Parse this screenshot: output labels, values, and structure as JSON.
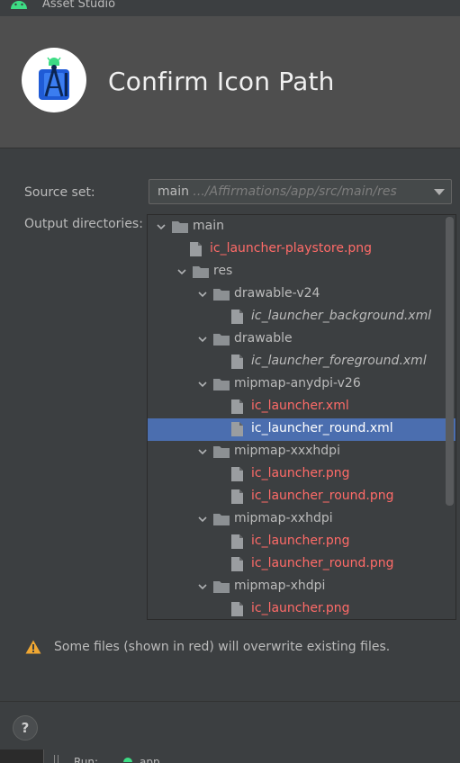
{
  "window": {
    "title": "Asset Studio"
  },
  "header": {
    "title": "Confirm Icon Path",
    "logo_icon": "android-studio-logo"
  },
  "form": {
    "source_set_label": "Source set:",
    "source_set_value": "main",
    "source_set_path": " .../Affirmations/app/src/main/res",
    "output_dirs_label": "Output directories:"
  },
  "tree": [
    {
      "text": "main",
      "kind": "folder",
      "expanded": true,
      "depth": 0,
      "red": false,
      "italic": false,
      "selected": false
    },
    {
      "text": "ic_launcher-playstore.png",
      "kind": "file",
      "depth": 1,
      "red": true,
      "italic": false,
      "selected": false
    },
    {
      "text": "res",
      "kind": "folder",
      "expanded": true,
      "depth": 1,
      "red": false,
      "italic": false,
      "selected": false
    },
    {
      "text": "drawable-v24",
      "kind": "folder",
      "expanded": true,
      "depth": 2,
      "red": false,
      "italic": false,
      "selected": false
    },
    {
      "text": "ic_launcher_background.xml",
      "kind": "file",
      "depth": 3,
      "red": false,
      "italic": true,
      "selected": false
    },
    {
      "text": "drawable",
      "kind": "folder",
      "expanded": true,
      "depth": 2,
      "red": false,
      "italic": false,
      "selected": false
    },
    {
      "text": "ic_launcher_foreground.xml",
      "kind": "file",
      "depth": 3,
      "red": false,
      "italic": true,
      "selected": false
    },
    {
      "text": "mipmap-anydpi-v26",
      "kind": "folder",
      "expanded": true,
      "depth": 2,
      "red": false,
      "italic": false,
      "selected": false
    },
    {
      "text": "ic_launcher.xml",
      "kind": "file",
      "depth": 3,
      "red": true,
      "italic": false,
      "selected": false
    },
    {
      "text": "ic_launcher_round.xml",
      "kind": "file",
      "depth": 3,
      "red": false,
      "italic": false,
      "selected": true
    },
    {
      "text": "mipmap-xxxhdpi",
      "kind": "folder",
      "expanded": true,
      "depth": 2,
      "red": false,
      "italic": false,
      "selected": false
    },
    {
      "text": "ic_launcher.png",
      "kind": "file",
      "depth": 3,
      "red": true,
      "italic": false,
      "selected": false
    },
    {
      "text": "ic_launcher_round.png",
      "kind": "file",
      "depth": 3,
      "red": true,
      "italic": false,
      "selected": false
    },
    {
      "text": "mipmap-xxhdpi",
      "kind": "folder",
      "expanded": true,
      "depth": 2,
      "red": false,
      "italic": false,
      "selected": false
    },
    {
      "text": "ic_launcher.png",
      "kind": "file",
      "depth": 3,
      "red": true,
      "italic": false,
      "selected": false
    },
    {
      "text": "ic_launcher_round.png",
      "kind": "file",
      "depth": 3,
      "red": true,
      "italic": false,
      "selected": false
    },
    {
      "text": "mipmap-xhdpi",
      "kind": "folder",
      "expanded": true,
      "depth": 2,
      "red": false,
      "italic": false,
      "selected": false
    },
    {
      "text": "ic_launcher.png",
      "kind": "file",
      "depth": 3,
      "red": true,
      "italic": false,
      "selected": false
    }
  ],
  "warning": {
    "icon": "warning-icon",
    "text": "Some files (shown in red) will overwrite existing files."
  },
  "footer": {
    "help_label": "?"
  },
  "bottombar": {
    "run_label": "Run:",
    "app_label": "app"
  },
  "colors": {
    "background": "#3c3f41",
    "header_bg": "#4e4e4e",
    "selection": "#4b6eaf",
    "overwrite_red": "#ff6b68",
    "warning_amber": "#f0a732",
    "folder_gray": "#8c9093"
  }
}
